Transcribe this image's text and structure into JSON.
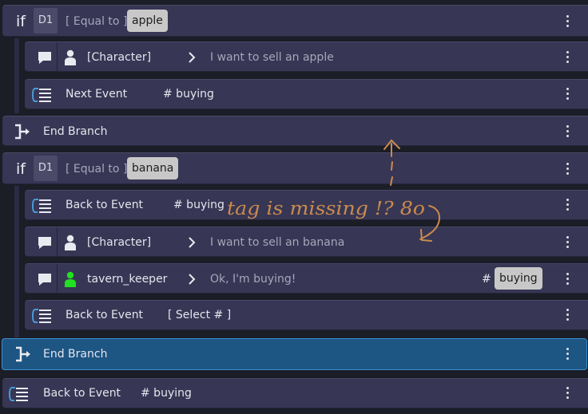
{
  "rows": [
    {
      "kind": "if",
      "keyword": "if",
      "var": "D1",
      "cond": "[ Equal to ]",
      "value": "apple"
    },
    {
      "kind": "text",
      "speaker": "[Character]",
      "arrow": ">",
      "text": "I want to sell an apple"
    },
    {
      "kind": "event",
      "label": "Next Event",
      "tag": "# buying"
    },
    {
      "kind": "end",
      "label": "End Branch"
    },
    {
      "kind": "if",
      "keyword": "if",
      "var": "D1",
      "cond": "[ Equal to ]",
      "value": "banana"
    },
    {
      "kind": "event",
      "label": "Back to Event",
      "tag": "# buying"
    },
    {
      "kind": "text",
      "speaker": "[Character]",
      "arrow": ">",
      "text": "I want to sell an banana"
    },
    {
      "kind": "text",
      "speaker": "tavern_keeper",
      "speaker_color": "#21e021",
      "arrow": ">",
      "text": "Ok, I'm buying!",
      "hash": "#",
      "tag_chip": "buying"
    },
    {
      "kind": "event",
      "label": "Back to Event",
      "tag": "[ Select # ]"
    },
    {
      "kind": "end",
      "label": "End Branch",
      "selected": true
    },
    {
      "kind": "event",
      "label": "Back to Event",
      "tag": "# buying"
    }
  ],
  "annotation": {
    "text": "tag is missing !? 8o",
    "color": "#c98b4d"
  },
  "colors": {
    "row": "#373654",
    "selected": "#1d5583",
    "background": "#1b1d27"
  },
  "icons": {
    "text": "speech-bubble-icon",
    "character": "person-icon",
    "event": "jump-event-icon",
    "end": "end-branch-icon",
    "menu": "kebab-menu-icon",
    "arrow": "chevron-right-icon"
  }
}
